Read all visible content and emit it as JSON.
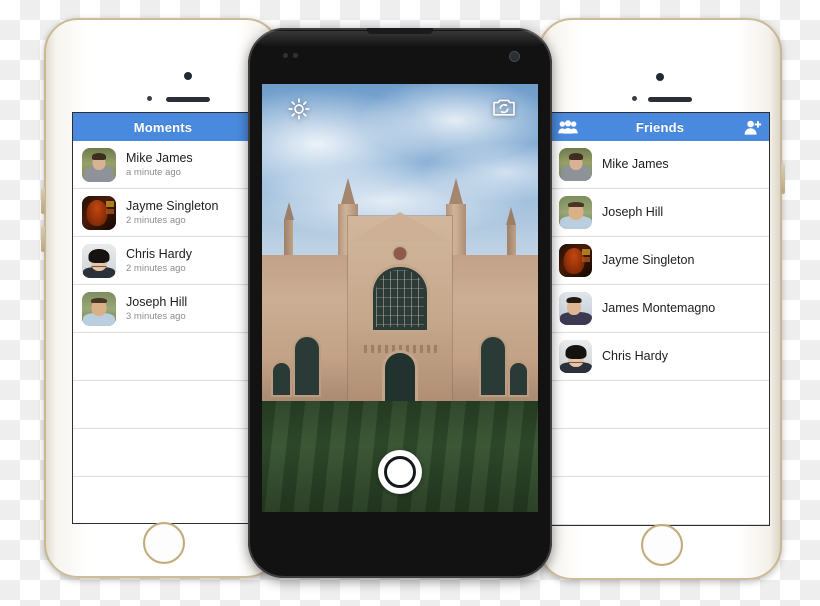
{
  "scene": {
    "description": "Three smartphone mockups showing a social app: Moments feed, camera viewfinder, Friends list",
    "accent_blue": "#4a8ade",
    "separator_color": "#dcdcdc"
  },
  "left_phone": {
    "device": "white-gold-iphone",
    "navbar": {
      "title": "Moments"
    },
    "items": [
      {
        "name": "Mike James",
        "time": "a minute ago",
        "avatar": "mike-james-avatar"
      },
      {
        "name": "Jayme Singleton",
        "time": "2 minutes ago",
        "avatar": "jayme-singleton-avatar"
      },
      {
        "name": "Chris Hardy",
        "time": "2 minutes ago",
        "avatar": "chris-hardy-avatar"
      },
      {
        "name": "Joseph Hill",
        "time": "3 minutes ago",
        "avatar": "joseph-hill-avatar"
      }
    ],
    "empty_rows": 4
  },
  "center_phone": {
    "device": "black-android",
    "camera": {
      "brightness_icon": "sun-icon",
      "flip_camera_icon": "camera-flip-icon",
      "shutter_icon": "shutter-button",
      "subject": "gothic-cathedral-facade-with-striped-lawn"
    }
  },
  "right_phone": {
    "device": "white-gold-iphone",
    "navbar": {
      "title": "Friends",
      "left_icon": "group-people-icon",
      "right_icon": "add-person-icon"
    },
    "items": [
      {
        "name": "Mike James",
        "avatar": "mike-james-avatar"
      },
      {
        "name": "Joseph Hill",
        "avatar": "joseph-hill-avatar"
      },
      {
        "name": "Jayme Singleton",
        "avatar": "jayme-singleton-avatar"
      },
      {
        "name": "James Montemagno",
        "avatar": "james-montemagno-avatar"
      },
      {
        "name": "Chris Hardy",
        "avatar": "chris-hardy-avatar"
      }
    ],
    "empty_rows": 3
  }
}
